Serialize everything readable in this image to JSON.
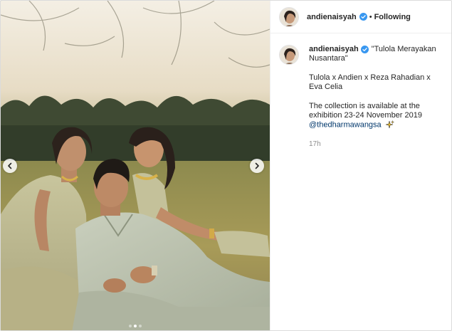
{
  "post": {
    "author": "andienaisyah",
    "header": {
      "separator": "•",
      "follow_label": "Following"
    },
    "caption": {
      "title": "\"Tulola Merayakan Nusantara\"",
      "credits": "Tulola x Andien x Reza Rahadian x Eva Celia",
      "availability": "The collection is available at the exhibition 23-24 November 2019",
      "mention": "@thedharmawangsa",
      "emoji": "sparkles"
    },
    "timestamp": "17h",
    "carousel": {
      "total_slides": 3,
      "active_slide": 2
    }
  },
  "icons": {
    "verified": "verified-badge-icon",
    "prev": "chevron-left-icon",
    "next": "chevron-right-icon"
  },
  "colors": {
    "verified_blue": "#3897f0",
    "mention_blue": "#00376b",
    "muted_gray": "#8e8e8e"
  }
}
